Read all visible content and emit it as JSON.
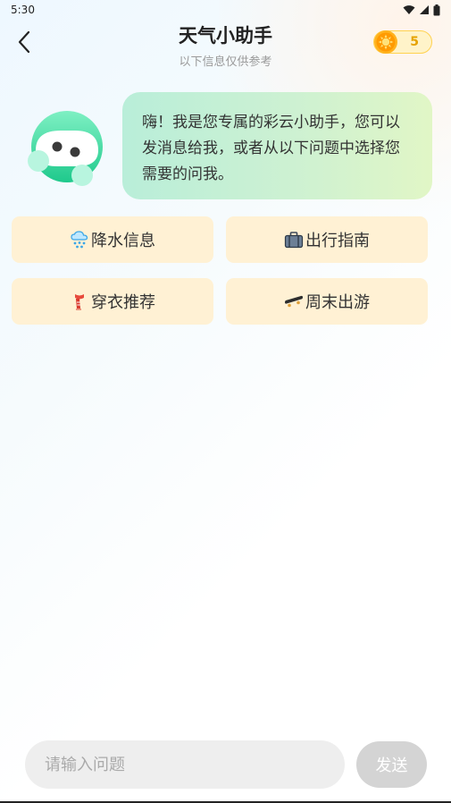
{
  "status_bar": {
    "time": "5:30"
  },
  "header": {
    "title": "天气小助手",
    "subtitle": "以下信息仅供参考",
    "coin_count": "5",
    "back_icon": "chevron-left-icon",
    "coin_icon": "sun-coin-icon"
  },
  "assistant": {
    "avatar_icon": "robot-avatar",
    "greeting": "嗨！我是您专属的彩云小助手，您可以发消息给我，或者从以下问题中选择您需要的问我。"
  },
  "suggestions": [
    {
      "label": "降水信息",
      "icon": "snow-cloud-icon"
    },
    {
      "label": "出行指南",
      "icon": "suitcase-icon"
    },
    {
      "label": "穿衣推荐",
      "icon": "scarf-icon"
    },
    {
      "label": "周末出游",
      "icon": "skateboard-icon"
    }
  ],
  "composer": {
    "placeholder": "请输入问题",
    "send_label": "发送"
  },
  "colors": {
    "bubble_start": "#b9eed9",
    "bubble_end": "#e1f6c6",
    "chip_bg": "#fff1d4",
    "coin_border": "#ffd24f",
    "coin_text": "#e6a300",
    "send_disabled": "#d4d4d4",
    "avatar_green": "#2fd39a"
  }
}
